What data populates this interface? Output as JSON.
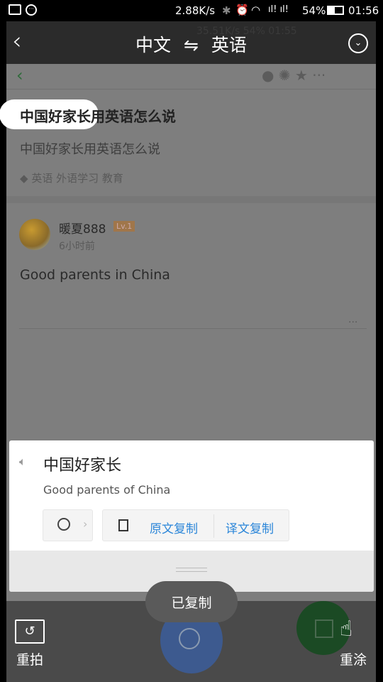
{
  "status_bar": {
    "speed": "2.88K/s",
    "battery": "54%",
    "time": "01:56"
  },
  "header": {
    "source_lang": "中文",
    "swap_symbol": "⇋",
    "target_lang": "英语",
    "ghost_status": "35.51K/s  54% 01:55"
  },
  "question": {
    "title": "中国好家长用英语怎么说",
    "subtitle": "中国好家长用英语怎么说",
    "tags": [
      "英语",
      "外语学习",
      "教育"
    ]
  },
  "answer": {
    "username": "暖夏888",
    "level": "Lv.1",
    "time": "6小时前",
    "text": "Good parents in China",
    "more": "···"
  },
  "popup": {
    "source_text": "中国好家长",
    "translation": "Good parents of China",
    "copy_original": "原文复制",
    "copy_translation": "译文复制"
  },
  "toast": "已复制",
  "bottom": {
    "retake": "重拍",
    "repaint": "重涂"
  },
  "colors": {
    "accent": "#2b86d9",
    "search_button": "#3d5a8f",
    "edit_button": "#1b4a24"
  }
}
